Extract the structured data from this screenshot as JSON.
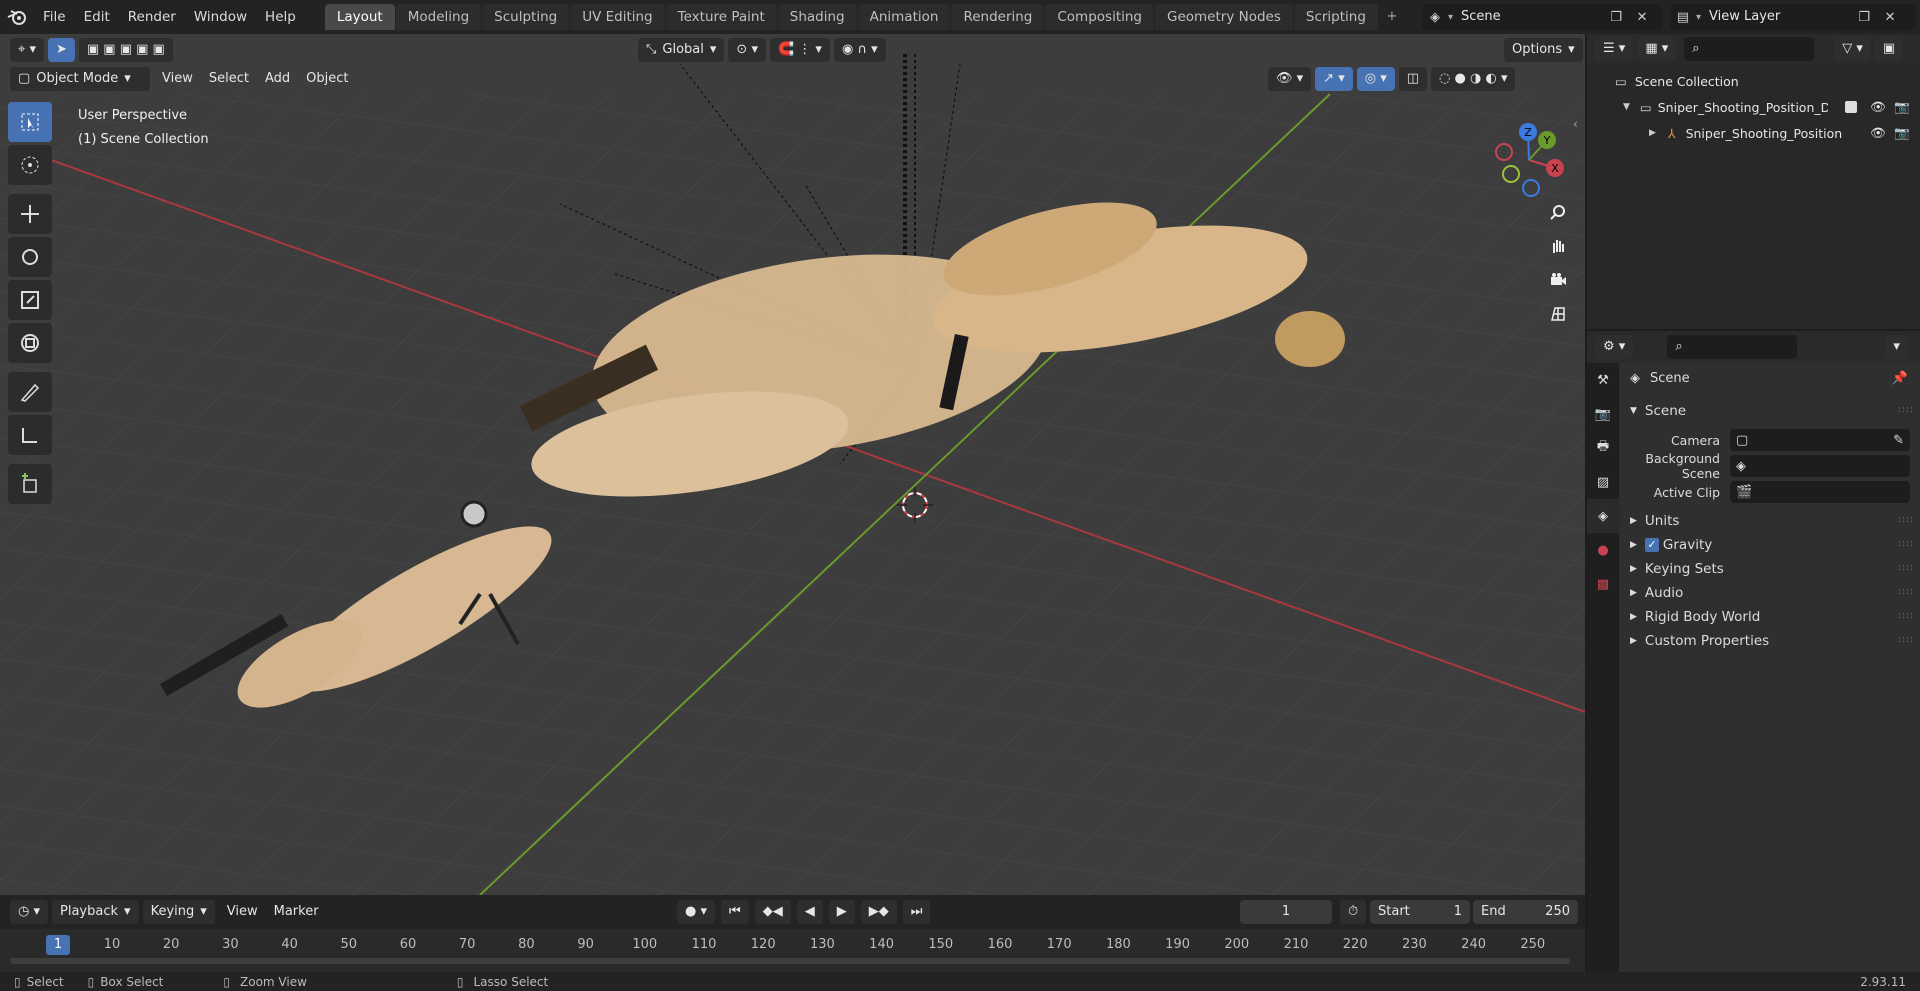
{
  "menubar": {
    "items": [
      "File",
      "Edit",
      "Render",
      "Window",
      "Help"
    ],
    "workspaces": [
      "Layout",
      "Modeling",
      "Sculpting",
      "UV Editing",
      "Texture Paint",
      "Shading",
      "Animation",
      "Rendering",
      "Compositing",
      "Geometry Nodes",
      "Scripting"
    ],
    "active_workspace": "Layout",
    "scene": "Scene",
    "view_layer": "View Layer"
  },
  "viewport": {
    "mode": "Object Mode",
    "menus": [
      "View",
      "Select",
      "Add",
      "Object"
    ],
    "transform_orientation": "Global",
    "options_label": "Options",
    "overlay_line1": "User Perspective",
    "overlay_line2": "(1) Scene Collection",
    "gizmo": {
      "x": "X",
      "y": "Y",
      "z": "Z"
    }
  },
  "outliner": {
    "root": "Scene Collection",
    "items": [
      {
        "label": "Sniper_Shooting_Position_Des"
      },
      {
        "label": "Sniper_Shooting_Position"
      }
    ]
  },
  "properties": {
    "context": "Scene",
    "section": "Scene",
    "fields": [
      {
        "label": "Camera"
      },
      {
        "label": "Background Scene"
      },
      {
        "label": "Active Clip"
      }
    ],
    "panels": [
      "Units",
      "Gravity",
      "Keying Sets",
      "Audio",
      "Rigid Body World",
      "Custom Properties"
    ],
    "gravity_checked": true
  },
  "timeline": {
    "menus": [
      "Playback",
      "Keying",
      "View",
      "Marker"
    ],
    "current_frame": "1",
    "start_label": "Start",
    "start": "1",
    "end_label": "End",
    "end": "250",
    "ticks": [
      "1",
      "10",
      "20",
      "30",
      "40",
      "50",
      "60",
      "70",
      "80",
      "90",
      "100",
      "110",
      "120",
      "130",
      "140",
      "150",
      "160",
      "170",
      "180",
      "190",
      "200",
      "210",
      "220",
      "230",
      "240",
      "250"
    ]
  },
  "statusbar": {
    "select": "Select",
    "box_select": "Box Select",
    "zoom_view": "Zoom View",
    "lasso_select": "Lasso Select",
    "version": "2.93.11"
  },
  "colors": {
    "accent": "#4772b3",
    "x_axis": "#c8434f",
    "y_axis": "#6a9a2a",
    "z_axis": "#3b7be0"
  }
}
